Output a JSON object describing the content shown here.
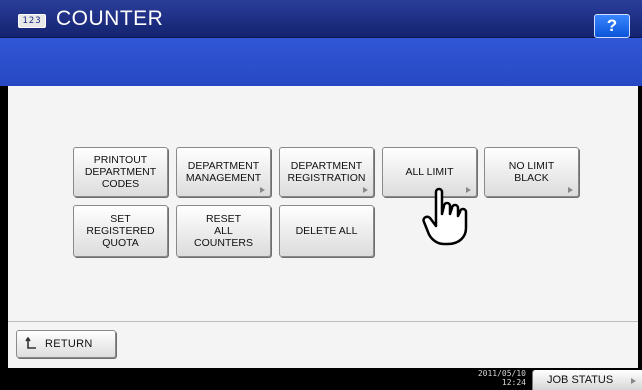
{
  "header": {
    "app_badge": "123",
    "title": "COUNTER",
    "help_label": "?"
  },
  "menu": {
    "printout_department_codes": "PRINTOUT\nDEPARTMENT\nCODES",
    "department_management": "DEPARTMENT\nMANAGEMENT",
    "department_registration": "DEPARTMENT\nREGISTRATION",
    "all_limit": "ALL LIMIT",
    "no_limit_black": "NO LIMIT\nBLACK",
    "set_registered_quota": "SET\nREGISTERED\nQUOTA",
    "reset_all_counters": "RESET\nALL\nCOUNTERS",
    "delete_all": "DELETE ALL"
  },
  "footer": {
    "return_label": "RETURN",
    "date": "2011/05/10",
    "time": "12:24",
    "job_status_label": "JOB STATUS"
  },
  "icons": {
    "return": "return-arrow-icon",
    "help": "help-icon",
    "pointer": "hand-pointer-icon"
  }
}
